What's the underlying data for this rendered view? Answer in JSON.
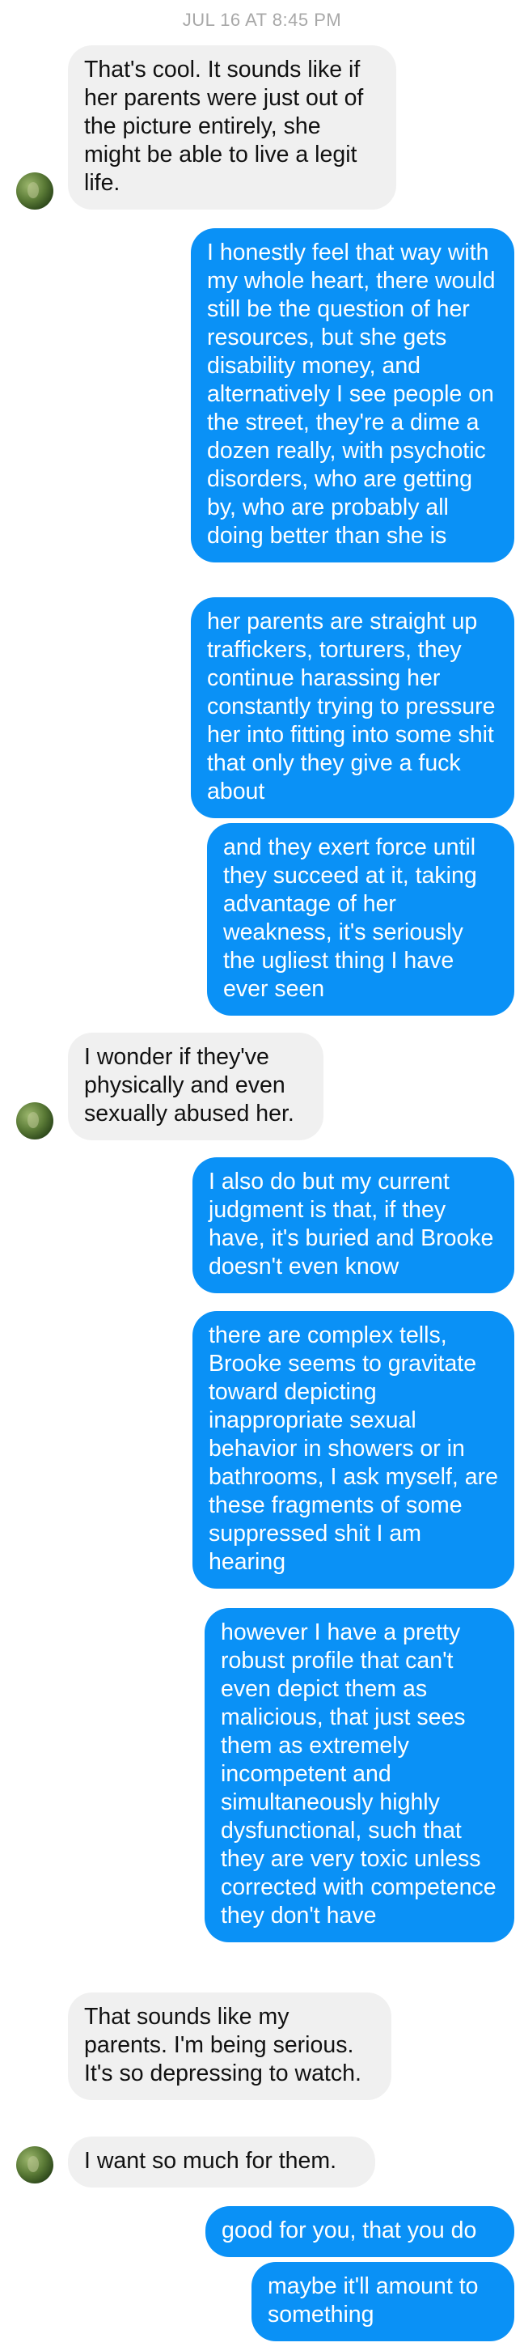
{
  "header": {
    "timestamp": "JUL 16 AT 8:45 PM"
  },
  "messages": [
    {
      "side": "in",
      "text": "That's cool. It sounds like if her parents were just out of the picture entirely, she might be able to live a legit life."
    },
    {
      "side": "out",
      "text": "I honestly feel that way with my whole heart, there would still be the question of her resources, but she gets disability money, and alternatively I see people on the street, they're a dime a dozen really, with psychotic disorders, who are getting by, who are probably all doing better than she is"
    },
    {
      "side": "out",
      "text": "her parents are straight up traffickers, torturers, they continue harassing her constantly trying to pressure her into fitting into some shit that only they give a fuck about"
    },
    {
      "side": "out",
      "text": "and they exert force until they succeed at it, taking advantage of her weakness, it's seriously the ugliest thing I have ever seen"
    },
    {
      "side": "in",
      "text": "I wonder if they've physically and even sexually abused her."
    },
    {
      "side": "out",
      "text": "I also do but my current judgment is that, if they have, it's buried and Brooke doesn't even know"
    },
    {
      "side": "out",
      "text": "there are complex tells, Brooke seems to gravitate toward depicting inappropriate sexual behavior in showers or in bathrooms, I ask myself, are these fragments of some suppressed shit I am hearing"
    },
    {
      "side": "out",
      "text": "however I have a pretty robust profile that can't even depict them as malicious, that just sees them as extremely incompetent and simultaneously highly dysfunctional, such that they are very toxic unless corrected with competence they don't have"
    },
    {
      "side": "in",
      "text": "That sounds like my parents. I'm being serious. It's so depressing to watch."
    },
    {
      "side": "in",
      "text": "I want so much for them."
    },
    {
      "side": "out",
      "text": "good for you, that you do"
    },
    {
      "side": "out",
      "text": "maybe it'll amount to something"
    }
  ],
  "colors": {
    "outgoing_bubble": "#0a91f6",
    "incoming_bubble": "#f0f0f0",
    "timestamp": "#a8a8a8"
  },
  "icons": {
    "contact_avatar": "avatar-icon"
  }
}
